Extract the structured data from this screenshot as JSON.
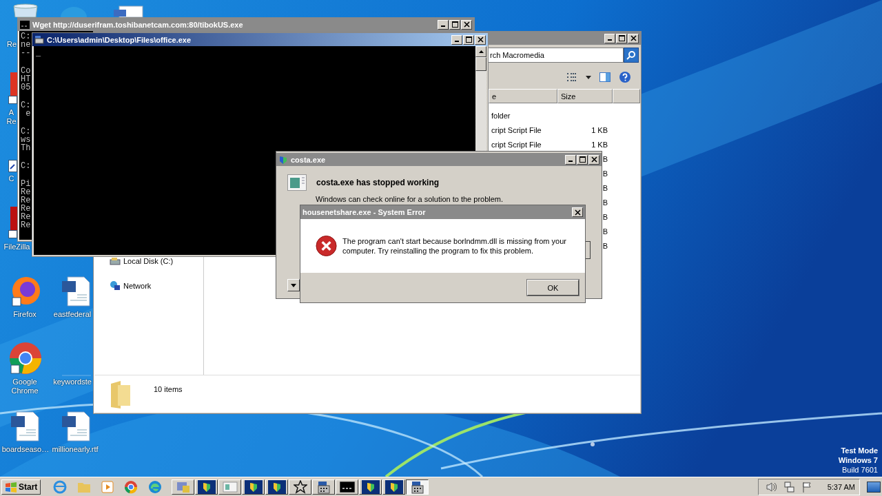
{
  "desktop": {
    "icons": [
      {
        "kind": "recycle",
        "lines": [
          "Re"
        ]
      },
      {
        "kind": "app"
      },
      {
        "kind": "doc"
      },
      {
        "kind": "acrobat",
        "lines": [
          "A",
          "Re"
        ]
      },
      {
        "kind": "shortcut",
        "lines": [
          "C"
        ]
      },
      {
        "kind": "filezilla",
        "lines": [
          "FileZilla"
        ]
      },
      {
        "kind": "firefox",
        "lines": [
          "Firefox"
        ]
      },
      {
        "kind": "word",
        "lines": [
          "eastfederal"
        ]
      },
      {
        "kind": "chrome",
        "lines": [
          "Google",
          "Chrome"
        ]
      },
      {
        "kind": "blank",
        "lines": [
          "keywordste"
        ]
      },
      {
        "kind": "word",
        "lines": [
          "boardseaso…"
        ]
      },
      {
        "kind": "word",
        "lines": [
          "millionearly.rtf"
        ]
      }
    ],
    "notice": [
      "Test Mode",
      "Windows 7",
      "Build 7601"
    ]
  },
  "wget_window": {
    "title": "Wget http://duserifram.toshibanetcam.com:80/tibokUS.exe",
    "blocks": [
      [
        "C:",
        "ne",
        "--"
      ],
      [
        "Co",
        "HT",
        "05"
      ],
      [
        "C:",
        " e"
      ],
      [
        "C:",
        "ws",
        "Th"
      ],
      [
        "C:"
      ],
      [
        "Pi",
        "Re",
        "Re",
        "Re",
        "Re",
        "Re"
      ]
    ]
  },
  "explorer": {
    "search": "rch Macromedia",
    "columns": [
      "e",
      "Size"
    ],
    "rows": [
      {
        "type": "folder"
      },
      {
        "type": "cript Script File",
        "size": "1 KB"
      },
      {
        "type": "cript Script File",
        "size": "1 KB"
      },
      {
        "size": "B"
      },
      {
        "size": "B"
      },
      {
        "size": "B"
      },
      {
        "size": "B"
      },
      {
        "size": "B"
      },
      {
        "size": "B"
      },
      {
        "size": "B"
      }
    ],
    "nav": [
      "Local Disk (C:)",
      "Network"
    ],
    "status": "10 items"
  },
  "console_window": {
    "title": "C:\\Users\\admin\\Desktop\\Files\\office.exe",
    "cursor": "_"
  },
  "crash_dialog": {
    "title": "costa.exe",
    "heading": "costa.exe has stopped working",
    "text": "Windows can check online for a solution to the problem."
  },
  "error_dialog": {
    "title": "housenetshare.exe - System Error",
    "message": "The program can't start because borlndmm.dll is missing from your computer. Try reinstalling the program to fix this problem.",
    "button": "OK"
  },
  "taskbar": {
    "start": "Start",
    "quick_launch": [
      {
        "kind": "ie"
      },
      {
        "kind": "folder"
      },
      {
        "kind": "media"
      },
      {
        "kind": "chrome"
      },
      {
        "kind": "edge"
      }
    ],
    "tasks": [
      {
        "kind": "installer",
        "selected": false
      },
      {
        "kind": "shield",
        "selected": false
      },
      {
        "kind": "panel",
        "selected": false
      },
      {
        "kind": "shield",
        "selected": false
      },
      {
        "kind": "shield",
        "selected": false
      },
      {
        "kind": "star",
        "selected": false
      },
      {
        "kind": "app",
        "selected": false
      },
      {
        "kind": "cmd",
        "selected": false
      },
      {
        "kind": "shield",
        "selected": false
      },
      {
        "kind": "shield",
        "selected": false
      },
      {
        "kind": "app",
        "selected": true
      }
    ],
    "tray": [
      {
        "kind": "volume"
      },
      {
        "kind": "network"
      },
      {
        "kind": "flag"
      }
    ],
    "clock": "5:37 AM"
  }
}
